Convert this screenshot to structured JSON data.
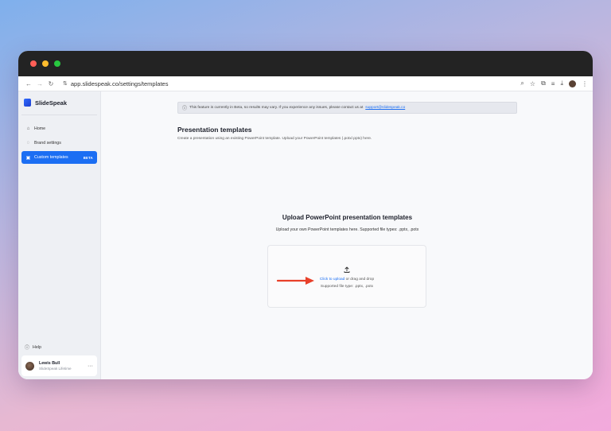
{
  "browser": {
    "url": "app.slidespeak.co/settings/templates"
  },
  "sidebar": {
    "brand": "SlideSpeak",
    "items": [
      {
        "label": "Home",
        "icon": "home-icon"
      },
      {
        "label": "Brand settings",
        "icon": "palette-icon"
      },
      {
        "label": "Custom templates",
        "icon": "template-icon",
        "badge": "BETA",
        "active": true
      }
    ],
    "help": "Help",
    "user": {
      "name": "Lewis Bull",
      "plan": "SlideSpeak Lifetime"
    }
  },
  "main": {
    "banner": {
      "text": "This feature is currently in Beta, so results may vary. If you experience any issues, please contact us at",
      "email": "support@slidespeak.co"
    },
    "title": "Presentation templates",
    "description": "Create a presentation using an existing PowerPoint template. Upload your PowerPoint templates (.potx/.pptx) here.",
    "upload": {
      "title": "Upload PowerPoint presentation templates",
      "subtitle": "Upload your own PowerPoint templates here. Supported file types: .pptx, .potx",
      "link": "Click to upload",
      "link_suffix": " or drag and drop",
      "filetypes": "Supported file type: .pptx, .potx"
    }
  },
  "colors": {
    "accent": "#1b6ef3",
    "arrow": "#e8402a"
  }
}
